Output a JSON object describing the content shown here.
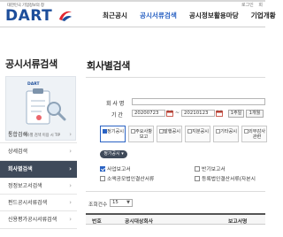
{
  "header": {
    "util_links": [
      "로그인",
      "회"
    ],
    "logo_caption": "대한민국 기업정보의 창",
    "logo_text": "DART",
    "nav": [
      "최근공시",
      "공시서류검색",
      "공시정보활용마당",
      "기업개황"
    ]
  },
  "sidebar": {
    "title": "공시서류검색",
    "banner_logo": "DART",
    "banner_caption": "회사별 검색 이용 시 TIP",
    "items": [
      {
        "label": "통합검색",
        "active": false
      },
      {
        "label": "상세검색",
        "active": false
      },
      {
        "label": "회사별검색",
        "active": true
      },
      {
        "label": "정정보고서검색",
        "active": false
      },
      {
        "label": "펀드공시서류검색",
        "active": false
      },
      {
        "label": "신용평가공시서류검색",
        "active": false
      }
    ]
  },
  "main": {
    "title": "회사별검색",
    "company_label": "회 사 명",
    "period_label": "기 간",
    "date_from": "20200723",
    "date_to": "20210123",
    "period_buttons": [
      "1주일",
      "1개월"
    ],
    "disclosure_types": [
      {
        "label": "정기공시",
        "active": true
      },
      {
        "label": "주요사항보고",
        "active": false
      },
      {
        "label": "발행공시",
        "active": false
      },
      {
        "label": "지분공시",
        "active": false
      },
      {
        "label": "기타공시",
        "active": false
      },
      {
        "label": "외부감사관련",
        "active": false
      }
    ],
    "subsection_label": "정기공시",
    "options": [
      {
        "label": "사업보고서",
        "checked": true
      },
      {
        "label": "반기보고서",
        "checked": false
      },
      {
        "label": "소액공모법인결산서류",
        "checked": false
      },
      {
        "label": "등록법인결산서류(자본시",
        "checked": false
      }
    ],
    "count_label": "조회건수",
    "count_value": "15",
    "table_headers": [
      "번호",
      "공시대상회사",
      "보고서명"
    ]
  },
  "colors": {
    "brand": "#1d4e9b",
    "accent": "#2b63c3",
    "sidebar_active": "#3f4a5a"
  }
}
